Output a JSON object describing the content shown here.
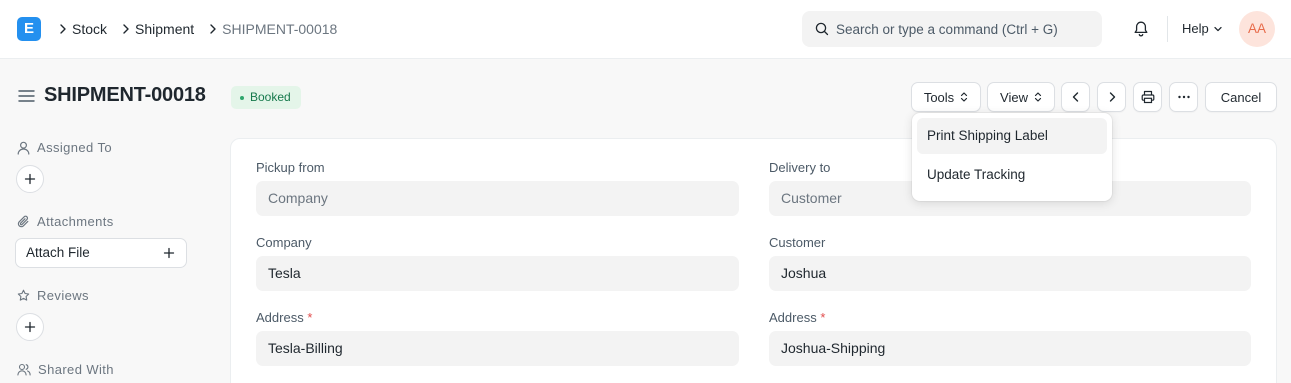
{
  "navbar": {
    "logo_letter": "E",
    "breadcrumbs": [
      "Stock",
      "Shipment",
      "SHIPMENT-00018"
    ],
    "search_placeholder": "Search or type a command (Ctrl + G)",
    "help_label": "Help",
    "avatar_initials": "AA"
  },
  "page": {
    "title": "SHIPMENT-00018",
    "status": "Booked",
    "status_color": "#16794c"
  },
  "toolbar": {
    "tools_label": "Tools",
    "view_label": "View",
    "cancel_label": "Cancel"
  },
  "tools_menu": [
    "Print Shipping Label",
    "Update Tracking"
  ],
  "sidebar": {
    "assigned_to": "Assigned To",
    "attachments": "Attachments",
    "attach_file": "Attach File",
    "reviews": "Reviews",
    "shared_with": "Shared With"
  },
  "form": {
    "pickup_from": {
      "label": "Pickup from",
      "value": "Company"
    },
    "delivery_to": {
      "label": "Delivery to",
      "value": "Customer"
    },
    "company": {
      "label": "Company",
      "value": "Tesla"
    },
    "customer": {
      "label": "Customer",
      "value": "Joshua"
    },
    "pickup_address": {
      "label": "Address",
      "required": "*",
      "value": "Tesla-Billing"
    },
    "delivery_address": {
      "label": "Address",
      "required": "*",
      "value": "Joshua-Shipping"
    }
  },
  "colors": {
    "accent": "#2490ef",
    "badge_bg": "#e4f5e9",
    "required": "#e24c4c"
  }
}
